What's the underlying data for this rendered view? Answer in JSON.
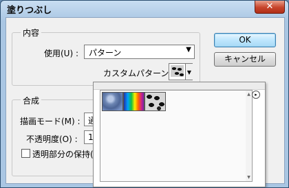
{
  "window": {
    "title": "塗りつぶし",
    "close_glyph": "✕"
  },
  "contents": {
    "legend": "内容",
    "use_label": "使用(U) :",
    "use_value": "パターン",
    "custom_pattern_label": "カスタムパターン :"
  },
  "blending": {
    "legend": "合成",
    "mode_label": "描画モード(M) :",
    "mode_value": "通",
    "opacity_label": "不透明度(O) :",
    "opacity_value": "1",
    "preserve_label": "透明部分の保持("
  },
  "buttons": {
    "ok": "OK",
    "cancel": "キャンセル"
  },
  "pattern_picker": {
    "menu_glyph": "▸",
    "patterns": [
      {
        "name": "bubbles",
        "icon": "bubbles-pattern-icon"
      },
      {
        "name": "tie-dye",
        "icon": "tie-dye-pattern-icon"
      },
      {
        "name": "spots",
        "icon": "spots-pattern-icon"
      }
    ]
  },
  "icons": {
    "dropdown": "▼",
    "scroll_up": "▲",
    "scroll_down": "▼"
  }
}
